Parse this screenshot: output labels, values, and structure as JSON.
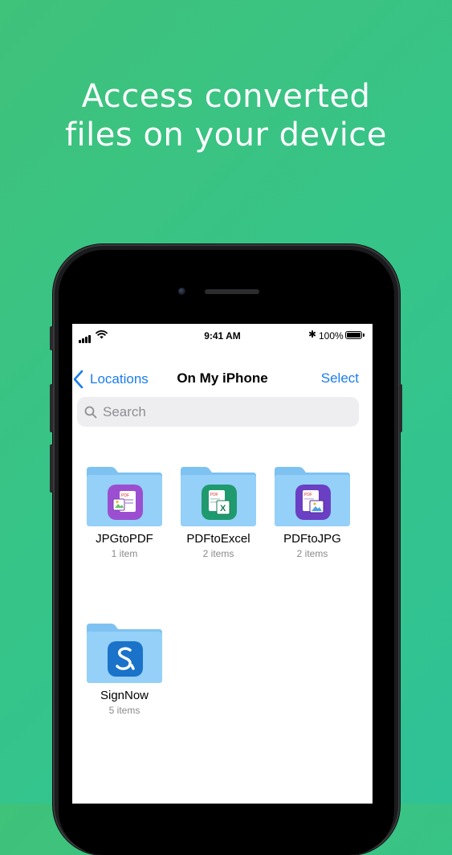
{
  "headline": {
    "line1": "Access converted",
    "line2": "files on your device"
  },
  "status_bar": {
    "time": "9:41 AM",
    "battery": "100%",
    "icons": [
      "signal-icon",
      "wifi-icon",
      "bluetooth-icon",
      "battery-icon"
    ]
  },
  "nav": {
    "back_label": "Locations",
    "title": "On My iPhone",
    "select_label": "Select"
  },
  "search": {
    "placeholder": "Search"
  },
  "folders": [
    {
      "name": "JPGtoPDF",
      "count": "1 item",
      "icon": "jpg-to-pdf-app-icon",
      "color": "#9b4fd0"
    },
    {
      "name": "PDFtoExcel",
      "count": "2 items",
      "icon": "pdf-to-excel-app-icon",
      "color": "#1f9a6e"
    },
    {
      "name": "PDFtoJPG",
      "count": "2 items",
      "icon": "pdf-to-jpg-app-icon",
      "color": "#6a3fc4"
    },
    {
      "name": "SignNow",
      "count": "5 items",
      "icon": "signnow-app-icon",
      "color": "#1a73c9"
    }
  ],
  "colors": {
    "background_start": "#3fc27a",
    "background_end": "#2fc296",
    "accent_blue": "#1a7cf0",
    "folder_blue": "#8ccaf6"
  }
}
